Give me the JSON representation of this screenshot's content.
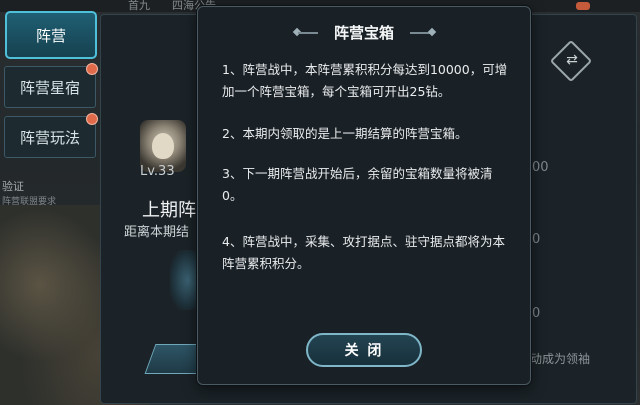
{
  "background": {
    "topbar_left": "首九",
    "topbar_mid": "四海公告",
    "side_tabs": [
      {
        "label": "阵营",
        "active": true
      },
      {
        "label": "阵营星宿",
        "badge": true
      },
      {
        "label": "阵营玩法",
        "badge": true
      }
    ],
    "side_caption": "验证",
    "side_caption2": "阵营联盟要求",
    "level": "Lv.33",
    "title": "上期阵",
    "subtitle": "距离本期结",
    "right_snip_1": "00",
    "right_snip_2": "0",
    "right_snip_3": "0",
    "right_text": "动成为领袖"
  },
  "modal": {
    "title": "阵营宝箱",
    "rules": [
      "1、阵营战中，本阵营累积积分每达到10000，可增加一个阵营宝箱，每个宝箱可开出25钻。",
      "2、本期内领取的是上一期结算的阵营宝箱。",
      "3、下一期阵营战开始后，余留的宝箱数量将被清0。",
      "4、阵营战中，采集、攻打据点、驻守据点都将为本阵营累积积分。"
    ],
    "close_label": "关 闭"
  },
  "colors": {
    "accent": "#4fc0da",
    "modal_bg": "#1a2126",
    "badge": "#e06a4a"
  }
}
